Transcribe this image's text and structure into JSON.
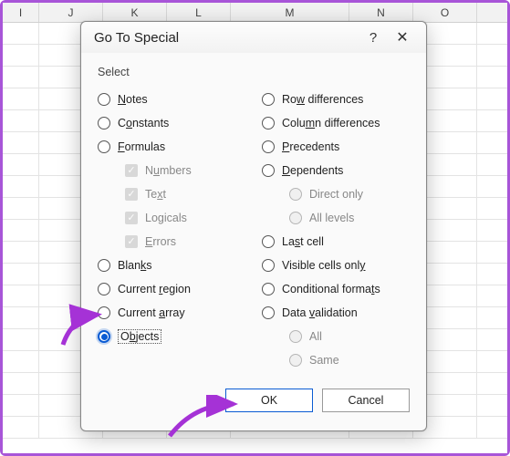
{
  "sheet": {
    "columns": [
      "I",
      "J",
      "K",
      "L",
      "M",
      "N",
      "O"
    ]
  },
  "dialog": {
    "title": "Go To Special",
    "section_label": "Select",
    "left": {
      "notes": "Notes",
      "constants": "Constants",
      "formulas": "Formulas",
      "numbers": "Numbers",
      "text": "Text",
      "logicals": "Logicals",
      "errors": "Errors",
      "blanks": "Blanks",
      "current_region": "Current region",
      "current_array": "Current array",
      "objects": "Objects"
    },
    "right": {
      "row_diff": "Row differences",
      "col_diff": "Column differences",
      "precedents": "Precedents",
      "dependents": "Dependents",
      "direct_only": "Direct only",
      "all_levels": "All levels",
      "last_cell": "Last cell",
      "visible_cells": "Visible cells only",
      "cond_formats": "Conditional formats",
      "data_validation": "Data validation",
      "all": "All",
      "same": "Same"
    },
    "buttons": {
      "ok": "OK",
      "cancel": "Cancel"
    }
  }
}
